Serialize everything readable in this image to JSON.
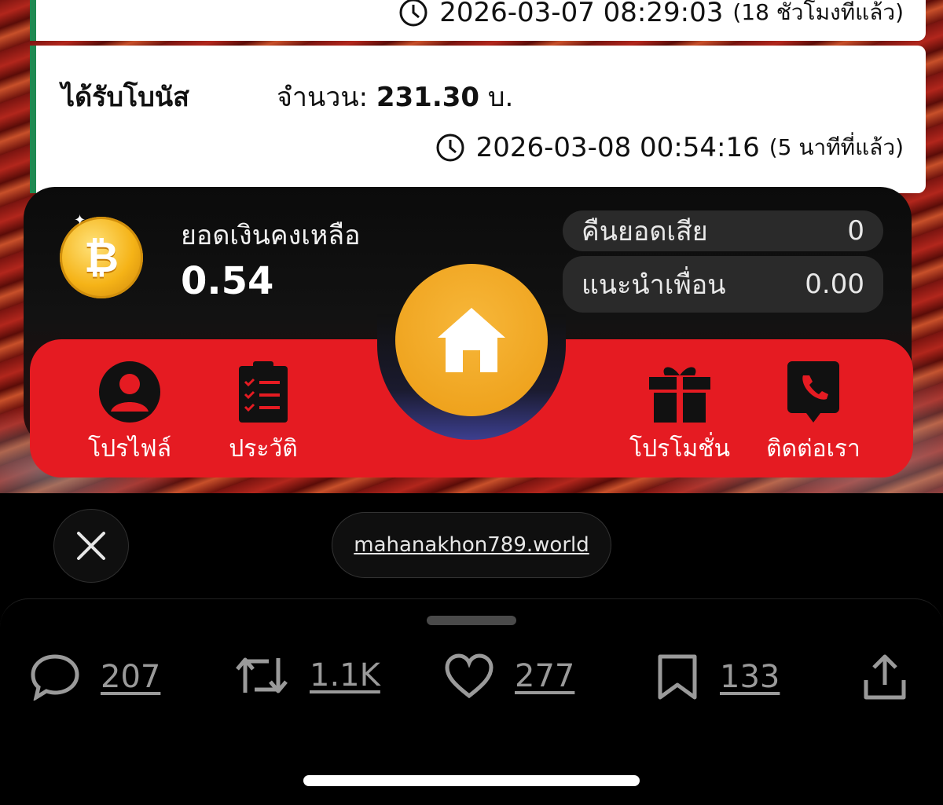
{
  "transactions": [
    {
      "timestamp": "2026-03-07 08:29:03",
      "ago": "(18 ชั่วโมงที่แล้ว)"
    },
    {
      "title": "ได้รับโบนัส",
      "amount_label": "จำนวน:",
      "amount_value": "231.30",
      "amount_unit": "บ.",
      "timestamp": "2026-03-08 00:54:16",
      "ago": "(5 นาทีที่แล้ว)"
    }
  ],
  "balance": {
    "label": "ยอดเงินคงเหลือ",
    "value": "0.54"
  },
  "stats": [
    {
      "label": "คืนยอดเสีย",
      "value": "0"
    },
    {
      "label": "แนะนำเพื่อน",
      "value": "0.00"
    }
  ],
  "nav": {
    "profile": "โปรไฟล์",
    "history": "ประวัติ",
    "promotion": "โปรโมชั่น",
    "contact": "ติดต่อเรา"
  },
  "browser": {
    "url": "mahanakhon789.world"
  },
  "actions": {
    "replies": "207",
    "reposts": "1.1K",
    "likes": "277",
    "bookmarks": "133"
  },
  "colors": {
    "accent_red": "#e51b22",
    "home_orange": "#f5a623",
    "coin_gold": "#f5b317",
    "card_border_green": "#1f8a52"
  }
}
